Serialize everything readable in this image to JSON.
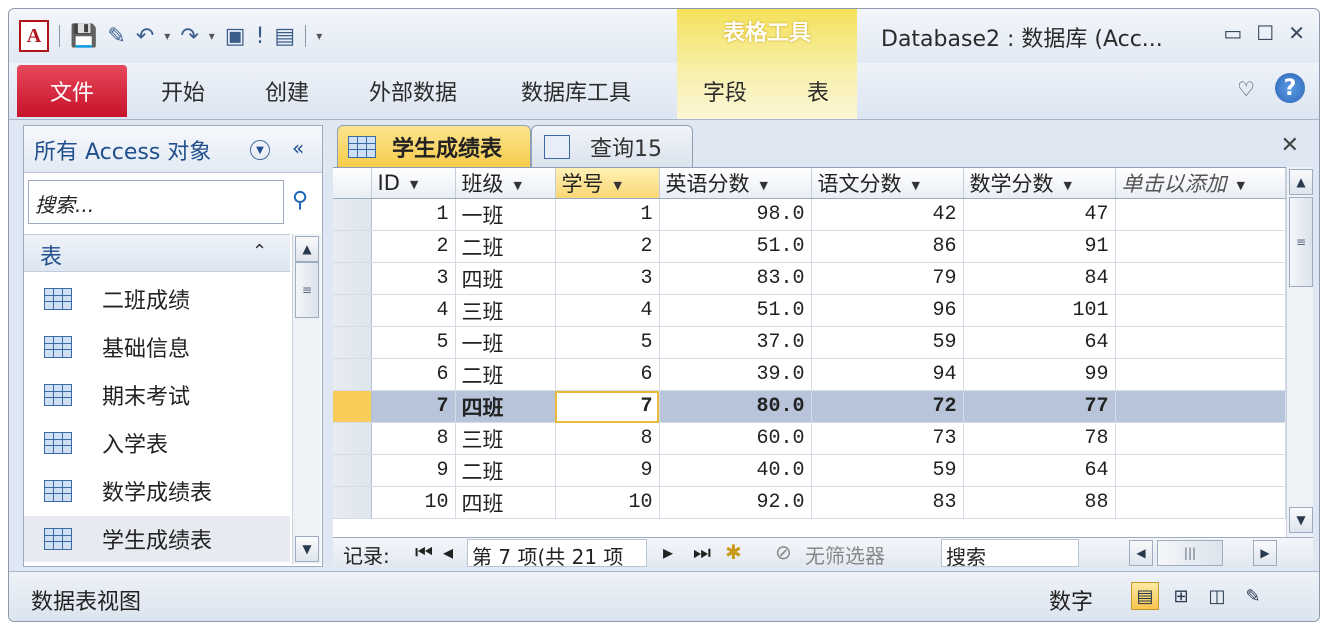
{
  "window": {
    "title": "Database2 : 数据库 (Acc...",
    "context_tab_title": "表格工具",
    "controls": [
      "▭",
      "☐",
      "✕"
    ]
  },
  "ribbon": {
    "file": "文件",
    "tabs": [
      "开始",
      "创建",
      "外部数据",
      "数据库工具",
      "字段",
      "表"
    ]
  },
  "nav": {
    "title": "所有 Access 对象",
    "collapse": "«",
    "search_placeholder": "搜索...",
    "group": "表",
    "items": [
      "二班成绩",
      "基础信息",
      "期末考试",
      "入学表",
      "数学成绩表",
      "学生成绩表"
    ]
  },
  "doc_tabs": [
    "学生成绩表",
    "查询15"
  ],
  "grid": {
    "columns": [
      "ID",
      "班级",
      "学号",
      "英语分数",
      "语文分数",
      "数学分数",
      "单击以添加"
    ],
    "rows": [
      [
        "1",
        "一班",
        "1",
        "98.0",
        "42",
        "47"
      ],
      [
        "2",
        "二班",
        "2",
        "51.0",
        "86",
        "91"
      ],
      [
        "3",
        "四班",
        "3",
        "83.0",
        "79",
        "84"
      ],
      [
        "4",
        "三班",
        "4",
        "51.0",
        "96",
        "101"
      ],
      [
        "5",
        "一班",
        "5",
        "37.0",
        "59",
        "64"
      ],
      [
        "6",
        "二班",
        "6",
        "39.0",
        "94",
        "99"
      ],
      [
        "7",
        "四班",
        "7",
        "80.0",
        "72",
        "77"
      ],
      [
        "8",
        "三班",
        "8",
        "60.0",
        "73",
        "78"
      ],
      [
        "9",
        "二班",
        "9",
        "40.0",
        "59",
        "64"
      ],
      [
        "10",
        "四班",
        "10",
        "92.0",
        "83",
        "88"
      ]
    ],
    "current_row": 6
  },
  "record_nav": {
    "label": "记录:",
    "position": "第 7 项(共 21 项",
    "filter": "无筛选器",
    "search": "搜索"
  },
  "status": {
    "left": "数据表视图",
    "mode": "数字"
  }
}
